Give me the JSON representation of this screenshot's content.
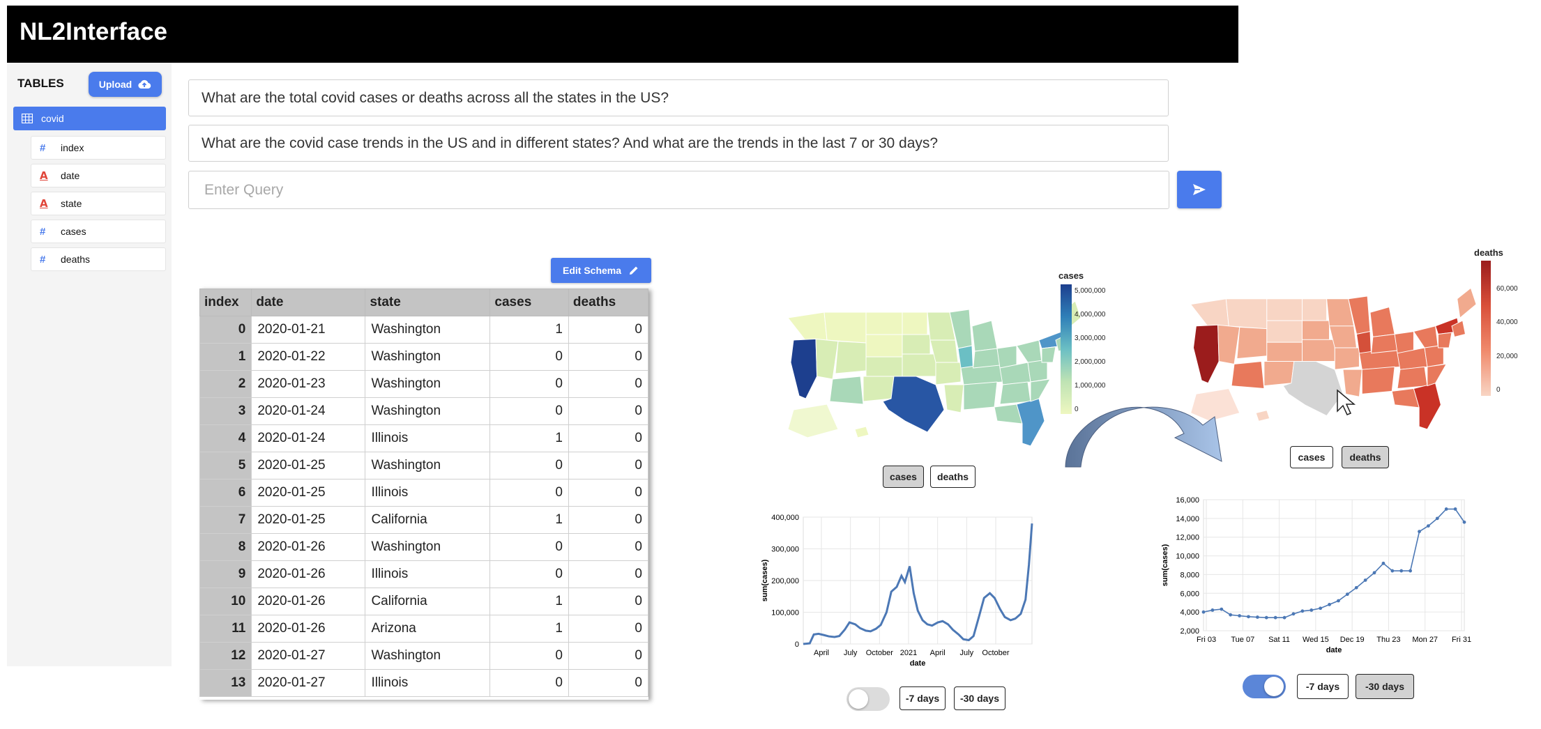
{
  "app": {
    "title": "NL2Interface"
  },
  "sidebar": {
    "tables_label": "TABLES",
    "upload_label": "Upload",
    "table": {
      "name": "covid",
      "icon": "table-icon"
    },
    "columns": [
      {
        "name": "index",
        "icon": "hash-icon",
        "type": "numeric"
      },
      {
        "name": "date",
        "icon": "text-type-icon",
        "type": "text"
      },
      {
        "name": "state",
        "icon": "text-type-icon",
        "type": "text"
      },
      {
        "name": "cases",
        "icon": "hash-icon",
        "type": "numeric"
      },
      {
        "name": "deaths",
        "icon": "hash-icon",
        "type": "numeric"
      }
    ]
  },
  "queries": [
    "What are the total covid cases or deaths across all the states in the US?",
    "What are the covid case trends in the US and in different states? And what are the trends in the last 7 or 30 days?"
  ],
  "query_input": {
    "placeholder": "Enter Query"
  },
  "edit_schema_label": "Edit Schema",
  "table": {
    "headers": [
      "index",
      "date",
      "state",
      "cases",
      "deaths"
    ],
    "rows": [
      [
        0,
        "2020-01-21",
        "Washington",
        1,
        0
      ],
      [
        1,
        "2020-01-22",
        "Washington",
        0,
        0
      ],
      [
        2,
        "2020-01-23",
        "Washington",
        0,
        0
      ],
      [
        3,
        "2020-01-24",
        "Washington",
        0,
        0
      ],
      [
        4,
        "2020-01-24",
        "Illinois",
        1,
        0
      ],
      [
        5,
        "2020-01-25",
        "Washington",
        0,
        0
      ],
      [
        6,
        "2020-01-25",
        "Illinois",
        0,
        0
      ],
      [
        7,
        "2020-01-25",
        "California",
        1,
        0
      ],
      [
        8,
        "2020-01-26",
        "Washington",
        0,
        0
      ],
      [
        9,
        "2020-01-26",
        "Illinois",
        0,
        0
      ],
      [
        10,
        "2020-01-26",
        "California",
        1,
        0
      ],
      [
        11,
        "2020-01-26",
        "Arizona",
        1,
        0
      ],
      [
        12,
        "2020-01-27",
        "Washington",
        0,
        0
      ],
      [
        13,
        "2020-01-27",
        "Illinois",
        0,
        0
      ]
    ]
  },
  "map_left": {
    "legend_title": "cases",
    "legend_ticks": [
      "5,000,000",
      "4,000,000",
      "3,000,000",
      "2,000,000",
      "1,000,000",
      "0"
    ],
    "buttons": [
      {
        "label": "cases",
        "active": true
      },
      {
        "label": "deaths",
        "active": false
      }
    ],
    "colors": {
      "low": "#eef7c0",
      "mid": "#6bbfc4",
      "high": "#1d3f8e"
    }
  },
  "map_right": {
    "legend_title": "deaths",
    "legend_ticks": [
      "60,000",
      "40,000",
      "20,000",
      "0"
    ],
    "buttons": [
      {
        "label": "cases",
        "active": false
      },
      {
        "label": "deaths",
        "active": true
      }
    ],
    "colors": {
      "low": "#f8d5c4",
      "high": "#9b1c1c",
      "missing": "#d4d4d4"
    }
  },
  "chart_left_controls": {
    "toggle_on": false,
    "buttons": [
      {
        "label": "-7 days",
        "active": false
      },
      {
        "label": "-30 days",
        "active": false
      }
    ]
  },
  "chart_right_controls": {
    "toggle_on": true,
    "buttons": [
      {
        "label": "-7 days",
        "active": false
      },
      {
        "label": "-30 days",
        "active": true
      }
    ]
  },
  "chart_data": [
    {
      "type": "line",
      "xlabel": "date",
      "ylabel": "sum(cases)",
      "x_ticks": [
        "April",
        "July",
        "October",
        "2021",
        "April",
        "July",
        "October"
      ],
      "y_ticks": [
        "400,000",
        "300,000",
        "200,000",
        "100,000",
        "0"
      ],
      "ylim": [
        0,
        400000
      ],
      "series": [
        {
          "x": [
            "2020-03-01",
            "2020-03-20",
            "2020-04-01",
            "2020-04-15",
            "2020-05-01",
            "2020-05-15",
            "2020-06-01",
            "2020-06-15",
            "2020-07-01",
            "2020-07-15",
            "2020-08-01",
            "2020-08-15",
            "2020-09-01",
            "2020-09-15",
            "2020-10-01",
            "2020-10-15",
            "2020-11-01",
            "2020-11-15",
            "2020-12-01",
            "2020-12-15",
            "2020-12-25",
            "2021-01-08",
            "2021-01-20",
            "2021-02-01",
            "2021-02-15",
            "2021-03-01",
            "2021-03-15",
            "2021-04-01",
            "2021-04-15",
            "2021-05-01",
            "2021-05-15",
            "2021-06-01",
            "2021-06-15",
            "2021-07-01",
            "2021-07-15",
            "2021-08-01",
            "2021-08-15",
            "2021-09-01",
            "2021-09-15",
            "2021-10-01",
            "2021-10-15",
            "2021-11-01",
            "2021-11-15",
            "2021-12-01",
            "2021-12-15",
            "2021-12-25",
            "2022-01-03"
          ],
          "y": [
            0,
            2000,
            30000,
            32000,
            28000,
            24000,
            22000,
            25000,
            45000,
            68000,
            62000,
            50000,
            42000,
            40000,
            48000,
            60000,
            100000,
            165000,
            180000,
            215000,
            195000,
            245000,
            160000,
            105000,
            75000,
            62000,
            58000,
            68000,
            72000,
            62000,
            45000,
            30000,
            15000,
            12000,
            25000,
            90000,
            145000,
            160000,
            145000,
            110000,
            85000,
            75000,
            80000,
            95000,
            140000,
            250000,
            380000
          ]
        }
      ]
    },
    {
      "type": "line",
      "xlabel": "date",
      "ylabel": "sum(cases)",
      "x_ticks": [
        "Fri 03",
        "Tue 07",
        "Sat 11",
        "Wed 15",
        "Dec 19",
        "Thu 23",
        "Mon 27",
        "Fri 31"
      ],
      "y_ticks": [
        "16,000",
        "14,000",
        "12,000",
        "10,000",
        "8,000",
        "6,000",
        "4,000",
        "2,000"
      ],
      "ylim": [
        2000,
        16000
      ],
      "series": [
        {
          "x": [
            "Dec 03",
            "Dec 04",
            "Dec 05",
            "Dec 06",
            "Dec 07",
            "Dec 08",
            "Dec 09",
            "Dec 10",
            "Dec 11",
            "Dec 12",
            "Dec 13",
            "Dec 14",
            "Dec 15",
            "Dec 16",
            "Dec 17",
            "Dec 18",
            "Dec 19",
            "Dec 20",
            "Dec 21",
            "Dec 22",
            "Dec 23",
            "Dec 24",
            "Dec 25",
            "Dec 26",
            "Dec 27",
            "Dec 28",
            "Dec 29",
            "Dec 30",
            "Dec 31",
            "Jan 01"
          ],
          "y": [
            4000,
            4200,
            4300,
            3700,
            3600,
            3500,
            3450,
            3400,
            3400,
            3400,
            3800,
            4100,
            4200,
            4400,
            4800,
            5200,
            5900,
            6600,
            7400,
            8200,
            9200,
            8400,
            8400,
            8400,
            12600,
            13200,
            14000,
            15000,
            15000,
            13600
          ]
        }
      ]
    }
  ]
}
